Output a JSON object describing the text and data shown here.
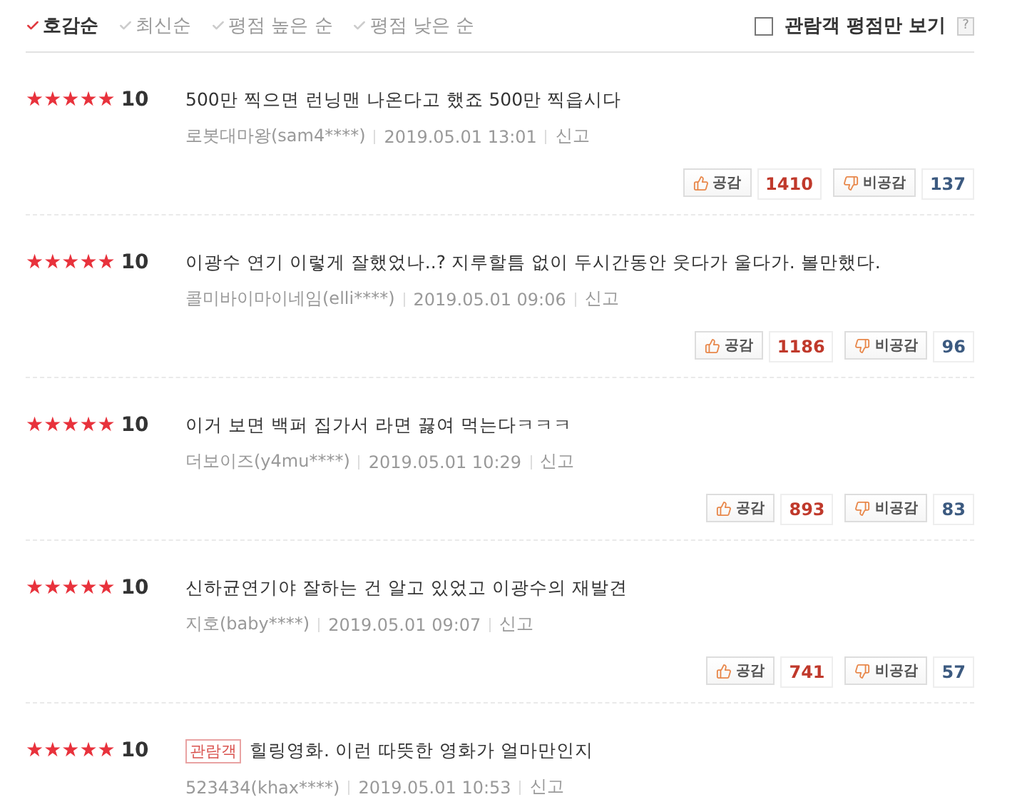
{
  "sort_options": [
    {
      "label": "호감순",
      "selected": true
    },
    {
      "label": "최신순",
      "selected": false
    },
    {
      "label": "평점 높은 순",
      "selected": false
    },
    {
      "label": "평점 낮은 순",
      "selected": false
    }
  ],
  "audience_filter": {
    "label": "관람객 평점만 보기",
    "checked": false,
    "help": "?"
  },
  "reviews": [
    {
      "stars": 5,
      "score": "10",
      "text": "500만 찍으면 런닝맨 나온다고 했죠 500만 찍읍시다",
      "author": "로봇대마왕(sam4****)",
      "date": "2019.05.01 13:01",
      "report": "신고",
      "like_label": "공감",
      "likes": "1410",
      "dislike_label": "비공감",
      "dislikes": "137"
    },
    {
      "stars": 5,
      "score": "10",
      "text": "이광수 연기 이렇게 잘했었나..? 지루할틈 없이 두시간동안 웃다가 울다가. 볼만했다.",
      "author": "콜미바이마이네임(elli****)",
      "date": "2019.05.01 09:06",
      "report": "신고",
      "like_label": "공감",
      "likes": "1186",
      "dislike_label": "비공감",
      "dislikes": "96"
    },
    {
      "stars": 5,
      "score": "10",
      "text": "이거 보면 백퍼 집가서 라면 끓여 먹는다ㅋㅋㅋ",
      "author": "더보이즈(y4mu****)",
      "date": "2019.05.01 10:29",
      "report": "신고",
      "like_label": "공감",
      "likes": "893",
      "dislike_label": "비공감",
      "dislikes": "83"
    },
    {
      "stars": 5,
      "score": "10",
      "text": "신하균연기야 잘하는 건 알고 있었고 이광수의 재발견",
      "author": "지호(baby****)",
      "date": "2019.05.01 09:07",
      "report": "신고",
      "like_label": "공감",
      "likes": "741",
      "dislike_label": "비공감",
      "dislikes": "57"
    },
    {
      "stars": 5,
      "score": "10",
      "badge": "관람객",
      "text": "힐링영화. 이런 따뜻한 영화가 얼마만인지",
      "author": "523434(khax****)",
      "date": "2019.05.01 10:53",
      "report": "신고"
    }
  ]
}
